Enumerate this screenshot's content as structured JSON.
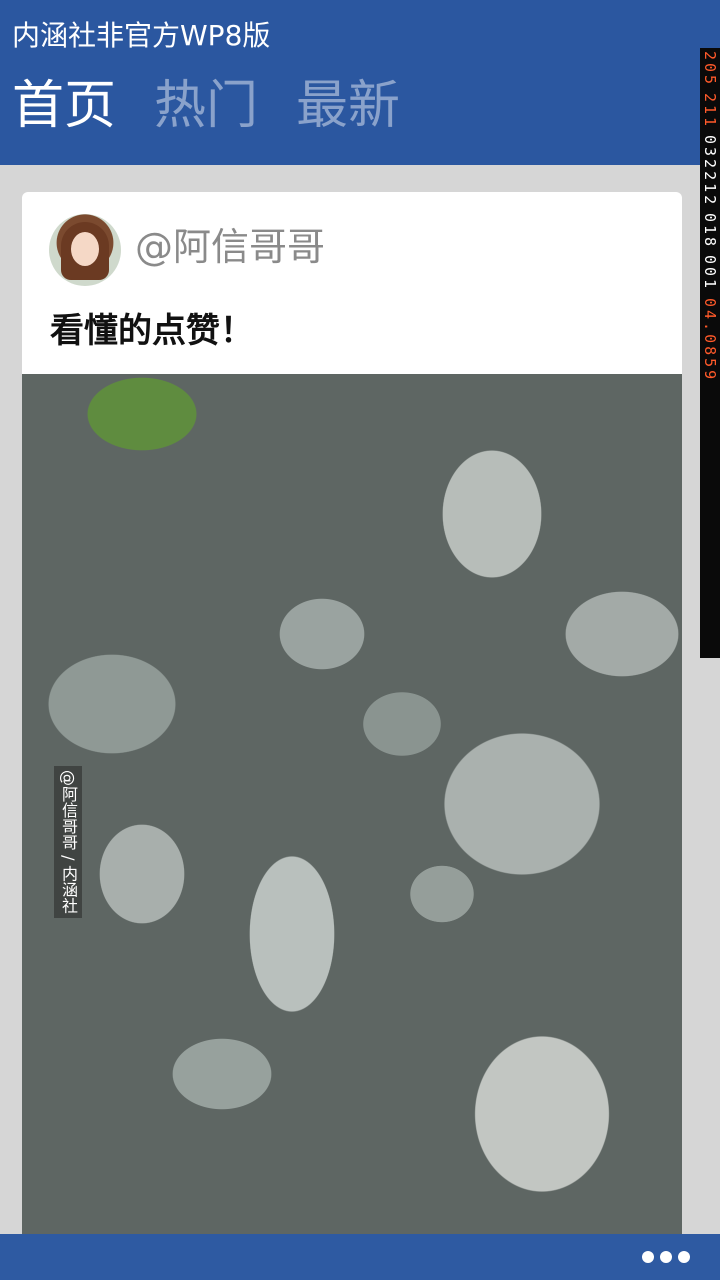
{
  "app": {
    "title": "内涵社非官方WP8版"
  },
  "pivot": {
    "tabs": [
      {
        "label": "首页",
        "active": true
      },
      {
        "label": "热门",
        "active": false
      },
      {
        "label": "最新",
        "active": false
      }
    ]
  },
  "debug_counter": [
    "205",
    "211",
    "032212",
    "018",
    "001",
    "04.0859"
  ],
  "post": {
    "username": "@阿信哥哥",
    "text": "看懂的点赞！",
    "image_watermark": "@阿信哥哥 / 内涵社"
  },
  "appbar": {
    "more_icon": "more-icon"
  },
  "colors": {
    "header": "#2b57a0",
    "appbar": "#2e5aa2",
    "background": "#d6d6d6"
  }
}
